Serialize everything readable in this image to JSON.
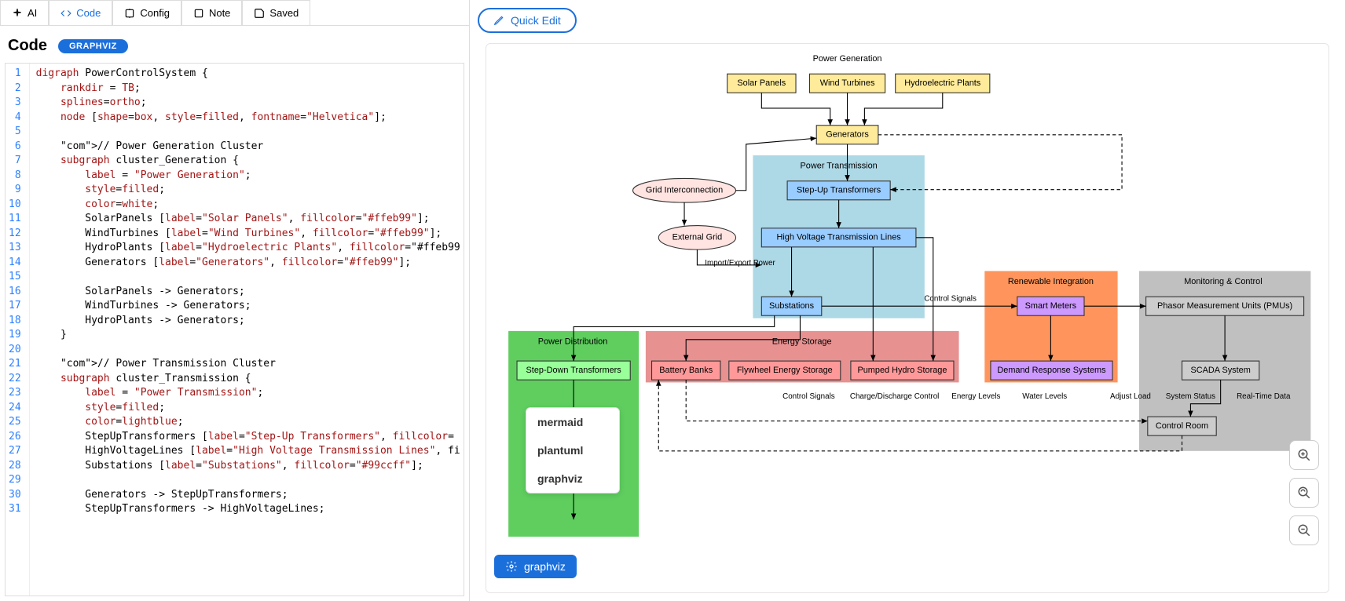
{
  "tabs": {
    "ai": "AI",
    "code": "Code",
    "config": "Config",
    "note": "Note",
    "saved": "Saved"
  },
  "header": {
    "title": "Code",
    "badge": "GRAPHVIZ"
  },
  "codeLines": [
    "digraph PowerControlSystem {",
    "    rankdir = TB;",
    "    splines=ortho;",
    "    node [shape=box, style=filled, fontname=\"Helvetica\"];",
    "",
    "    // Power Generation Cluster",
    "    subgraph cluster_Generation {",
    "        label = \"Power Generation\";",
    "        style=filled;",
    "        color=white;",
    "        SolarPanels [label=\"Solar Panels\", fillcolor=\"#ffeb99\"];",
    "        WindTurbines [label=\"Wind Turbines\", fillcolor=\"#ffeb99\"];",
    "        HydroPlants [label=\"Hydroelectric Plants\", fillcolor=\"#ffeb99",
    "        Generators [label=\"Generators\", fillcolor=\"#ffeb99\"];",
    "",
    "        SolarPanels -> Generators;",
    "        WindTurbines -> Generators;",
    "        HydroPlants -> Generators;",
    "    }",
    "",
    "    // Power Transmission Cluster",
    "    subgraph cluster_Transmission {",
    "        label = \"Power Transmission\";",
    "        style=filled;",
    "        color=lightblue;",
    "        StepUpTransformers [label=\"Step-Up Transformers\", fillcolor=",
    "        HighVoltageLines [label=\"High Voltage Transmission Lines\", fi",
    "        Substations [label=\"Substations\", fillcolor=\"#99ccff\"];",
    "",
    "        Generators -> StepUpTransformers;",
    "        StepUpTransformers -> HighVoltageLines;"
  ],
  "quickEdit": "Quick Edit",
  "engineDropdown": {
    "options": [
      "mermaid",
      "plantuml",
      "graphviz"
    ],
    "selected": "graphviz"
  },
  "diagram": {
    "clusters": {
      "generation": "Power Generation",
      "transmission": "Power Transmission",
      "distribution": "Power Distribution",
      "storage": "Energy Storage",
      "renewable": "Renewable Integration",
      "monitoring": "Monitoring & Control"
    },
    "nodes": {
      "solarPanels": "Solar Panels",
      "windTurbines": "Wind Turbines",
      "hydroPlants": "Hydroelectric Plants",
      "generators": "Generators",
      "gridInterconnection": "Grid Interconnection",
      "externalGrid": "External Grid",
      "stepUpTransformers": "Step-Up Transformers",
      "highVoltageLines": "High Voltage Transmission Lines",
      "substations": "Substations",
      "stepDownTransformers": "Step-Down Transformers",
      "batteryBanks": "Battery Banks",
      "flywheelStorage": "Flywheel Energy Storage",
      "pumpedHydro": "Pumped Hydro Storage",
      "smartMeters": "Smart Meters",
      "demandResponse": "Demand Response Systems",
      "pmus": "Phasor Measurement Units (PMUs)",
      "scada": "SCADA System",
      "controlRoom": "Control Room"
    },
    "edgeLabels": {
      "importExport": "Import/Export Power",
      "controlSignals1": "Control Signals",
      "controlSignals2": "Control Signals",
      "chargeDischarge": "Charge/Discharge Control",
      "energyLevels": "Energy Levels",
      "waterLevels": "Water Levels",
      "adjustLoad": "Adjust Load",
      "systemStatus": "System Status",
      "realTimeData": "Real-Time Data"
    }
  }
}
